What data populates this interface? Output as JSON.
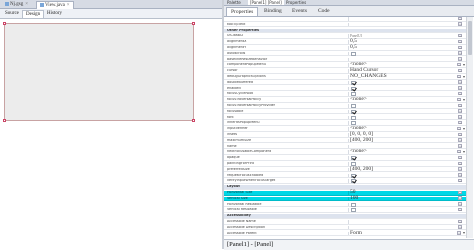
{
  "left": {
    "file_tabs": [
      {
        "label": "Nj.gsg",
        "active": false
      },
      {
        "label": "View.java",
        "active": true
      }
    ],
    "editor_tabs": [
      {
        "label": "Source",
        "active": false
      },
      {
        "label": "Design",
        "active": true
      },
      {
        "label": "History",
        "active": false
      }
    ]
  },
  "right": {
    "title_tabs": [
      "Palette",
      "[Panel1] [Panel]",
      "Properties"
    ],
    "sub_tabs": [
      {
        "label": "Properties",
        "active": true
      },
      {
        "label": "Binding",
        "active": false
      },
      {
        "label": "Events",
        "active": false
      },
      {
        "label": "Code",
        "active": false
      }
    ],
    "status": "[Panel1] - [Panel]"
  },
  "rows": [
    {
      "name": "",
      "value": "",
      "kind": "text"
    },
    {
      "name": "toolTipText",
      "value": "",
      "kind": "text"
    },
    {
      "name": "Other Properties",
      "kind": "cat"
    },
    {
      "name": "UIClassID",
      "value": "PanelUI",
      "kind": "small"
    },
    {
      "name": "alignmentX",
      "value": "0,5",
      "kind": "text"
    },
    {
      "name": "alignmentY",
      "value": "0,5",
      "kind": "text"
    },
    {
      "name": "autoscrolls",
      "value": "",
      "kind": "check",
      "checked": false
    },
    {
      "name": "baselineResizeBehavior",
      "value": "",
      "kind": "text"
    },
    {
      "name": "componentPopupMenu",
      "value": "<none>",
      "kind": "dropdown"
    },
    {
      "name": "cursor",
      "value": "Hand Cursor",
      "kind": "text"
    },
    {
      "name": "debugGraphicsOptions",
      "value": "NO_CHANGES",
      "kind": "dropdown"
    },
    {
      "name": "doubleBuffered",
      "value": "",
      "kind": "check",
      "checked": true
    },
    {
      "name": "enabled",
      "value": "",
      "kind": "check",
      "checked": true
    },
    {
      "name": "focusCycleRoot",
      "value": "",
      "kind": "check",
      "checked": false
    },
    {
      "name": "focusTraversalPolicy",
      "value": "<none>",
      "kind": "dropdown"
    },
    {
      "name": "focusTraversalPolicyProvider",
      "value": "",
      "kind": "check",
      "checked": false
    },
    {
      "name": "focusable",
      "value": "",
      "kind": "check",
      "checked": true
    },
    {
      "name": "font",
      "value": "",
      "kind": "check",
      "checked": false
    },
    {
      "name": "inheritsPopupMenu",
      "value": "",
      "kind": "check",
      "checked": false
    },
    {
      "name": "inputVerifier",
      "value": "<none>",
      "kind": "dropdown"
    },
    {
      "name": "insets",
      "value": "[0, 0, 0, 0]",
      "kind": "text"
    },
    {
      "name": "maximumSize",
      "value": "[400, 200]",
      "kind": "text"
    },
    {
      "name": "name",
      "value": "",
      "kind": "text"
    },
    {
      "name": "nextFocusableComponent",
      "value": "<none>",
      "kind": "dropdown"
    },
    {
      "name": "opaque",
      "value": "",
      "kind": "check",
      "checked": true
    },
    {
      "name": "paintingForPrint",
      "value": "",
      "kind": "check",
      "checked": false
    },
    {
      "name": "preferredSize",
      "value": "[400, 200]",
      "kind": "text"
    },
    {
      "name": "requestFocusEnabled",
      "value": "",
      "kind": "check",
      "checked": true
    },
    {
      "name": "verifyInputWhenFocusTarget",
      "value": "",
      "kind": "check",
      "checked": true
    },
    {
      "name": "Layout",
      "kind": "cat"
    },
    {
      "name": "Horizontal Size",
      "value": "50",
      "kind": "hl"
    },
    {
      "name": "Vertical Size",
      "value": "100",
      "kind": "hl"
    },
    {
      "name": "Horizontal Resizable",
      "value": "",
      "kind": "check",
      "checked": false
    },
    {
      "name": "Vertical Resizable",
      "value": "",
      "kind": "check",
      "checked": false
    },
    {
      "name": "Accessibility",
      "kind": "cat"
    },
    {
      "name": "Accessible Name",
      "value": "",
      "kind": "text"
    },
    {
      "name": "Accessible Description",
      "value": "",
      "kind": "text"
    },
    {
      "name": "Accessible Parent",
      "value": "Form",
      "kind": "dropdown"
    }
  ]
}
